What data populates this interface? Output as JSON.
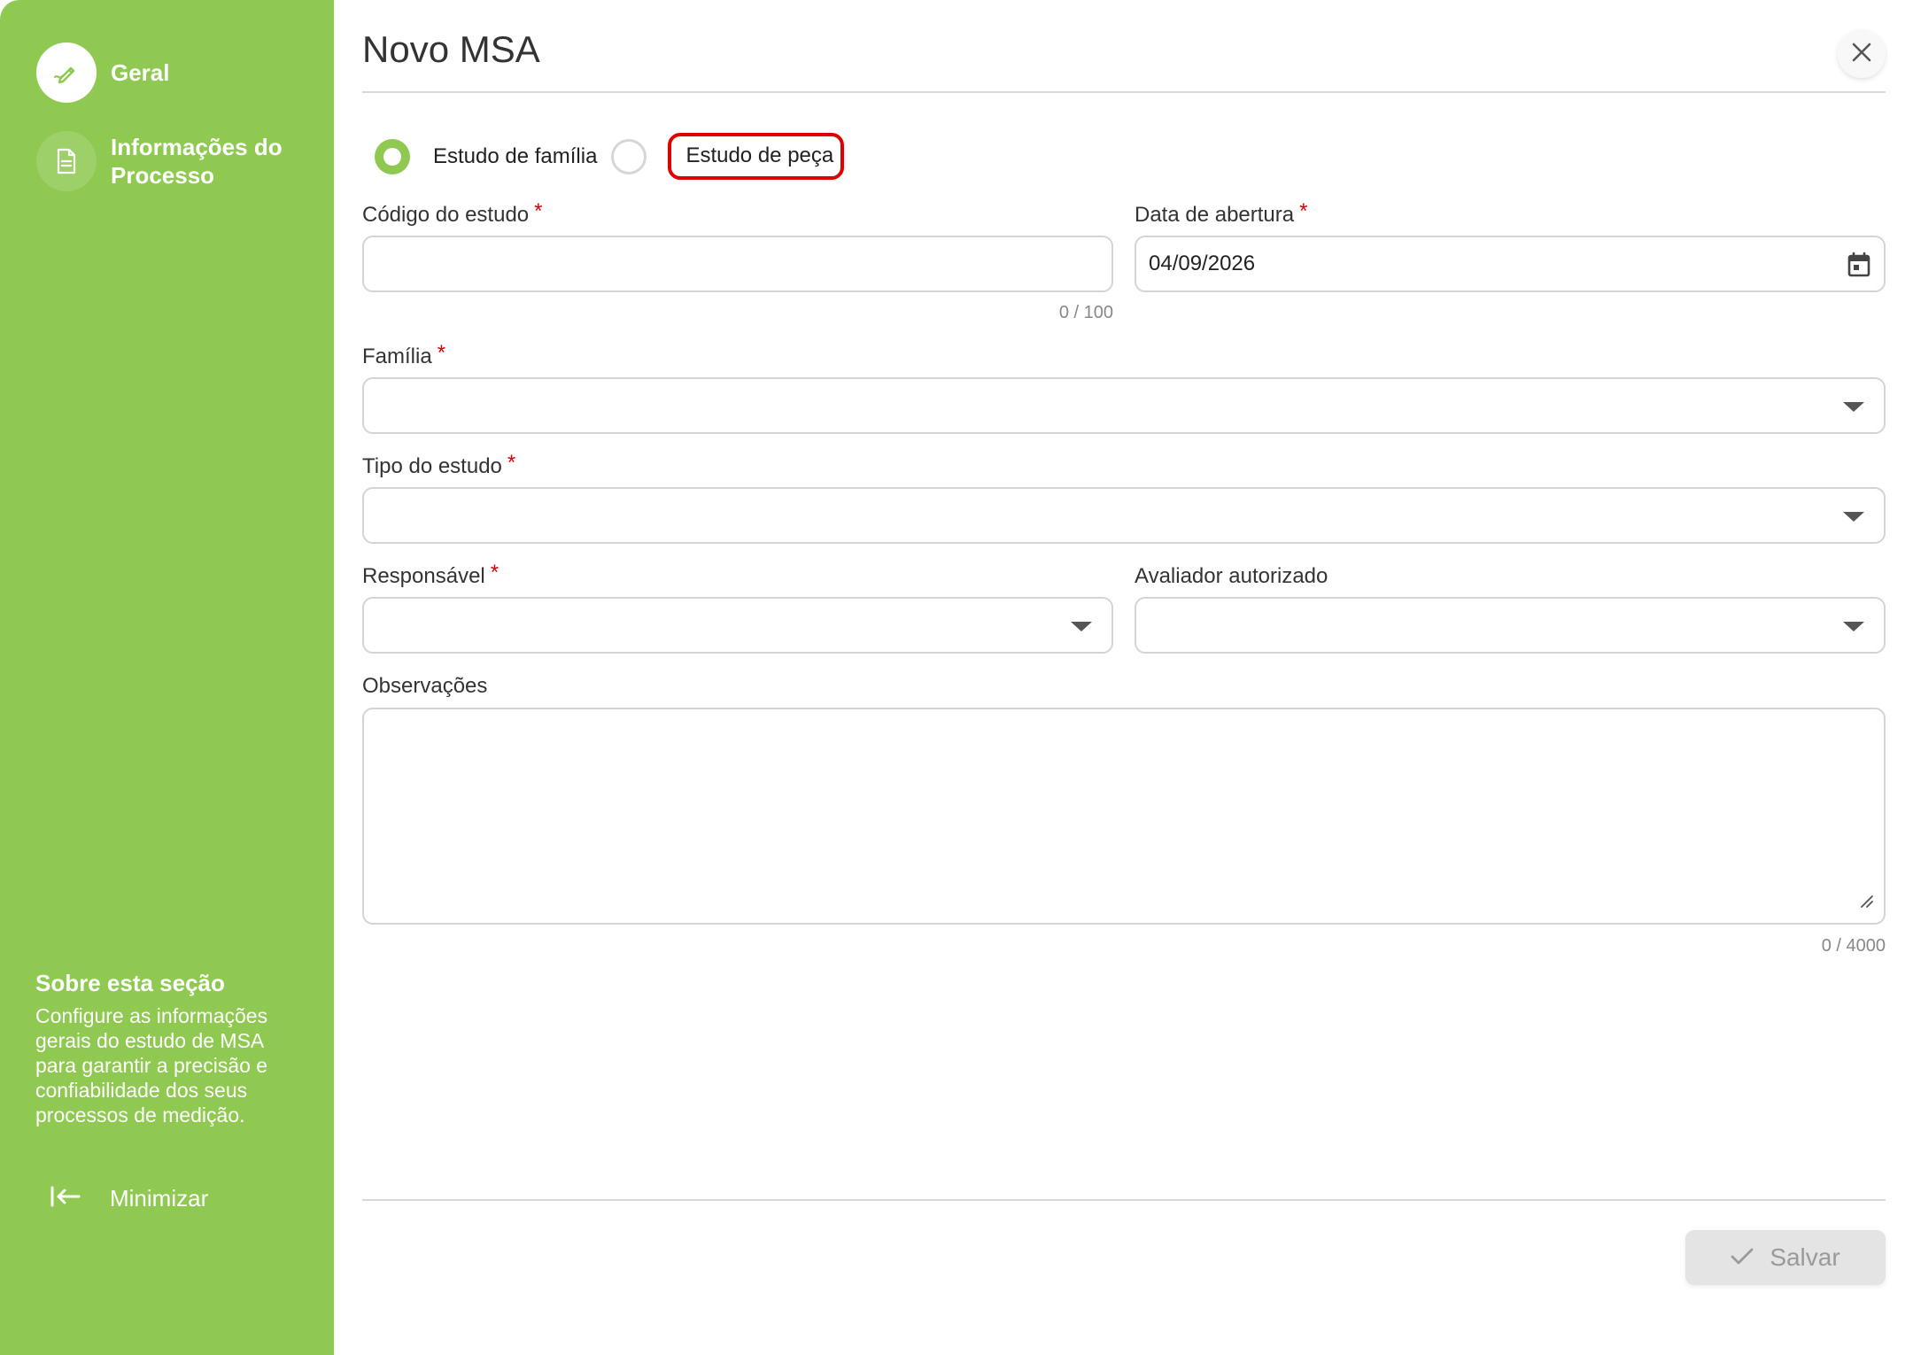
{
  "sidebar": {
    "items": [
      {
        "label": "Geral",
        "icon": "pencil-icon",
        "active": true
      },
      {
        "label": "Informações do Processo",
        "icon": "document-icon",
        "active": false
      }
    ],
    "about_title": "Sobre esta seção",
    "about_text": "Configure as informações gerais do estudo de MSA para garantir a precisão e confiabilidade dos seus processos de medição.",
    "minimize_label": "Minimizar"
  },
  "header": {
    "title": "Novo MSA"
  },
  "study_type": {
    "options": [
      "Estudo de família",
      "Estudo de peça"
    ],
    "selected": "Estudo de família"
  },
  "form": {
    "codigo": {
      "label": "Código do estudo",
      "value": "",
      "counter": "0 / 100"
    },
    "data_abertura": {
      "label": "Data de abertura",
      "value": "04/09/2026"
    },
    "familia": {
      "label": "Família",
      "value": ""
    },
    "tipo": {
      "label": "Tipo do estudo",
      "value": ""
    },
    "responsavel": {
      "label": "Responsável",
      "value": ""
    },
    "avaliador": {
      "label": "Avaliador autorizado",
      "value": ""
    },
    "observacoes": {
      "label": "Observações",
      "value": "",
      "counter": "0 / 4000"
    },
    "required_mark": "*"
  },
  "footer": {
    "save_label": "Salvar"
  },
  "colors": {
    "accent": "#8fc951",
    "required": "#e00000",
    "highlight": "#e00000"
  }
}
